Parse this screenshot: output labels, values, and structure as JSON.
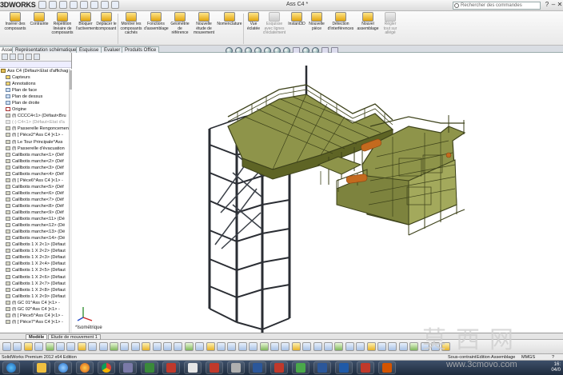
{
  "app": {
    "brand": "3DWORKS",
    "doc_title": "Ass C4 *",
    "search_placeholder": "Rechercher des commandes",
    "window_buttons": [
      "?",
      "–",
      "❐",
      "✕"
    ]
  },
  "ribbon": {
    "buttons": [
      {
        "label": "Insérer des composants",
        "disabled": false
      },
      {
        "label": "Contrainte",
        "disabled": false
      },
      {
        "label": "Répétition linéaire de composants",
        "disabled": false
      },
      {
        "label": "Bloquer l'activement",
        "disabled": false
      },
      {
        "label": "Déplacer le composant",
        "disabled": false
      },
      {
        "label": "Montrer les composants cachés",
        "disabled": false
      },
      {
        "label": "Fonctions d'assemblage",
        "disabled": false
      },
      {
        "label": "Géométrie de référence",
        "disabled": false
      },
      {
        "label": "Nouvelle étude de mouvement",
        "disabled": false
      },
      {
        "label": "Nomenclature",
        "disabled": false
      },
      {
        "label": "Vue éclatée",
        "disabled": false
      },
      {
        "label": "Esquisse avec lignes d'éclatement",
        "disabled": true
      },
      {
        "label": "Instant3D",
        "disabled": false
      },
      {
        "label": "Nouvelle pièce",
        "disabled": false
      },
      {
        "label": "Détection d'interférences",
        "disabled": false
      },
      {
        "label": "Nouvel assemblage",
        "disabled": false
      },
      {
        "label": "Régler tout sur allégé",
        "disabled": true
      }
    ]
  },
  "tabs": [
    {
      "label": "Assemblage",
      "active": true
    },
    {
      "label": "Représentation schématique",
      "active": false
    },
    {
      "label": "Esquisse",
      "active": false
    },
    {
      "label": "Evaluer",
      "active": false
    },
    {
      "label": "Produits Office",
      "active": false
    }
  ],
  "tree": {
    "items": [
      {
        "label": "Ass C4  (Défaut<Etat d'affichag",
        "icon": "asm",
        "dim": false
      },
      {
        "label": "Capteurs",
        "icon": "folder",
        "dim": false
      },
      {
        "label": "Annotations",
        "icon": "folder",
        "dim": false
      },
      {
        "label": "Plan de face",
        "icon": "plane",
        "dim": false
      },
      {
        "label": "Plan de dessus",
        "icon": "plane",
        "dim": false
      },
      {
        "label": "Plan de droite",
        "icon": "plane",
        "dim": false
      },
      {
        "label": "Origine",
        "icon": "orig",
        "dim": false
      },
      {
        "label": "(f) CCCC4<1> (Défaut<Bru",
        "icon": "part",
        "dim": false
      },
      {
        "label": "(-) C4<1> (Défaut<Etat d'a",
        "icon": "dim",
        "dim": true
      },
      {
        "label": "(f) Passerelle  Rengoncement",
        "icon": "part",
        "dim": false
      },
      {
        "label": "(f) [ Pièce2^Ass C4 ]<1> -",
        "icon": "part",
        "dim": false
      },
      {
        "label": "(f) Le Tour Principale^Ass",
        "icon": "part",
        "dim": false
      },
      {
        "label": "(f) Passerelle d'évacuation",
        "icon": "part",
        "dim": false
      },
      {
        "label": "Caillbotis marche<1> (Déf",
        "icon": "part",
        "dim": false
      },
      {
        "label": "Caillbotis marche<2> (Déf",
        "icon": "part",
        "dim": false
      },
      {
        "label": "Caillbotis marche<3> (Déf",
        "icon": "part",
        "dim": false
      },
      {
        "label": "Caillbotis marche<4> (Déf",
        "icon": "part",
        "dim": false
      },
      {
        "label": "(f) [ Pièce6^Ass C4 ]<1> -",
        "icon": "part",
        "dim": false
      },
      {
        "label": "Caillbotis marche<5> (Déf",
        "icon": "part",
        "dim": false
      },
      {
        "label": "Caillbotis marche<6> (Déf",
        "icon": "part",
        "dim": false
      },
      {
        "label": "Caillbotis marche<7> (Déf",
        "icon": "part",
        "dim": false
      },
      {
        "label": "Caillbotis marche<8> (Déf",
        "icon": "part",
        "dim": false
      },
      {
        "label": "Caillbotis marche<9> (Déf",
        "icon": "part",
        "dim": false
      },
      {
        "label": "Caillbotis marche<11> (Dé",
        "icon": "part",
        "dim": false
      },
      {
        "label": "Caillbotis marche<12> (Dé",
        "icon": "part",
        "dim": false
      },
      {
        "label": "Caillbotis marche<13> (Dé",
        "icon": "part",
        "dim": false
      },
      {
        "label": "Caillbotis marche<14> (Dé",
        "icon": "part",
        "dim": false
      },
      {
        "label": "Caillbotis 1 X 2<1> (Défaut",
        "icon": "part",
        "dim": false
      },
      {
        "label": "Caillbotis 1 X 2<2> (Défaut",
        "icon": "part",
        "dim": false
      },
      {
        "label": "Caillbotis 1 X 2<3> (Défaut",
        "icon": "part",
        "dim": false
      },
      {
        "label": "Caillbotis 1 X 2<4> (Défaut",
        "icon": "part",
        "dim": false
      },
      {
        "label": "Caillbotis 1 X 2<5> (Défaut",
        "icon": "part",
        "dim": false
      },
      {
        "label": "Caillbotis 1 X 2<6> (Défaut",
        "icon": "part",
        "dim": false
      },
      {
        "label": "Caillbotis 1 X 2<7> (Défaut",
        "icon": "part",
        "dim": false
      },
      {
        "label": "Caillbotis 1 X 2<8> (Défaut",
        "icon": "part",
        "dim": false
      },
      {
        "label": "Caillbotis 1 X 2<9> (Défaut",
        "icon": "part",
        "dim": false
      },
      {
        "label": "(f) GC 01^Ass C4 ]<1> -",
        "icon": "part",
        "dim": false
      },
      {
        "label": "(f) GC 02^Ass C4 ]<1> -",
        "icon": "part",
        "dim": false
      },
      {
        "label": "(f) [ Pièce5^Ass C4 ]<1> -",
        "icon": "part",
        "dim": false
      },
      {
        "label": "(f) [ Pièce7^Ass C4 ]<1> -",
        "icon": "part",
        "dim": false
      }
    ]
  },
  "viewport": {
    "view_label": "*Isométrique",
    "colors": {
      "frame": "#2a2d33",
      "platform": "#9aa055",
      "platform_dark": "#4c5220",
      "pipe": "#c46a1e",
      "handrail": "#3d421a"
    }
  },
  "bottom_tabs": [
    {
      "label": "Modèle",
      "active": true
    },
    {
      "label": "Étude de mouvement 1",
      "active": false
    }
  ],
  "status": {
    "left": "SolidWorks Premium 2012 x64 Edition",
    "mid1": "Sous-contraint",
    "mid2": "Edition Assemblage",
    "units": "MMGS",
    "help": "?"
  },
  "taskbar": {
    "time": "16:",
    "date": "04/0"
  },
  "watermark": {
    "chars": "莫西网",
    "url": "www.3cmovo.com"
  }
}
